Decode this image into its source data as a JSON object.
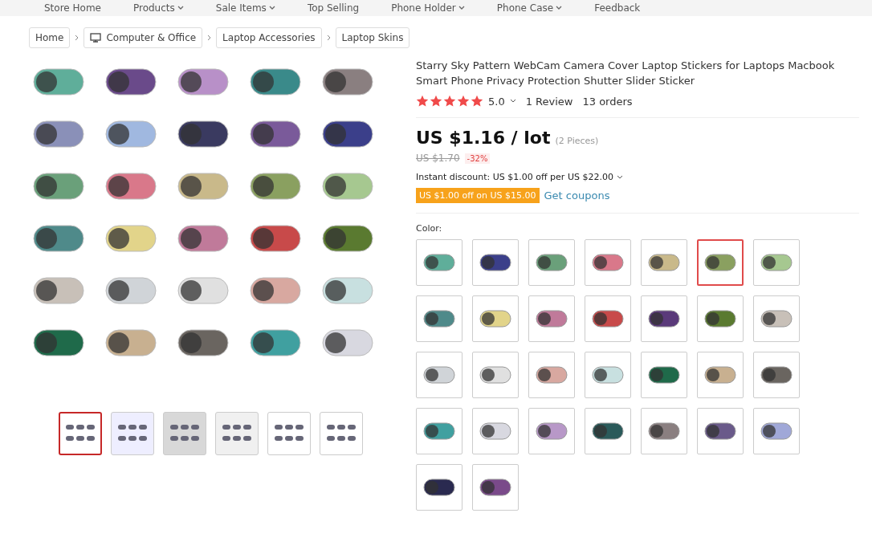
{
  "nav": [
    "Store Home",
    "Products",
    "Sale Items",
    "Top Selling",
    "Phone Holder",
    "Phone Case",
    "Feedback"
  ],
  "nav_dropdown": [
    false,
    true,
    true,
    false,
    true,
    true,
    false
  ],
  "breadcrumb": [
    {
      "label": "Home",
      "kind": "plain"
    },
    {
      "label": "Computer & Office",
      "kind": "icon"
    },
    {
      "label": "Laptop Accessories",
      "kind": "plain"
    },
    {
      "label": "Laptop Skins",
      "kind": "plain"
    }
  ],
  "thumbnails": [
    {
      "selected": true
    },
    {
      "selected": false
    },
    {
      "selected": false
    },
    {
      "selected": false
    },
    {
      "selected": false
    },
    {
      "selected": false
    }
  ],
  "product": {
    "title": "Starry Sky Pattern WebCam Camera Cover Laptop Stickers for Laptops Macbook Smart Phone Privacy Protection Shutter Slider Sticker",
    "stars": 5,
    "rating": "5.0",
    "reviews": "1 Review",
    "orders": "13 orders",
    "price": "US $1.16 / lot",
    "pieces": "(2 Pieces)",
    "old_price": "US $1.70",
    "discount": "-32%",
    "instant_discount": "Instant discount: US $1.00 off per US $22.00",
    "coupon": "US $1.00 off on US $15.00",
    "coupon_link": "Get coupons",
    "color_label": "Color:"
  },
  "swatches": [
    {
      "color": "#5fae9a",
      "selected": false
    },
    {
      "color": "#3b3f8a",
      "selected": false
    },
    {
      "color": "#6aa07a",
      "selected": false
    },
    {
      "color": "#d9788a",
      "selected": false
    },
    {
      "color": "#c9b98a",
      "selected": false
    },
    {
      "color": "#8aa060",
      "selected": true
    },
    {
      "color": "#a6c890",
      "selected": false
    },
    {
      "color": "#4f8a8a",
      "selected": false
    },
    {
      "color": "#e2d48a",
      "selected": false
    },
    {
      "color": "#c07a9a",
      "selected": false
    },
    {
      "color": "#c84a4a",
      "selected": false
    },
    {
      "color": "#5a3a7a",
      "selected": false
    },
    {
      "color": "#5a7a30",
      "selected": false
    },
    {
      "color": "#c8c0b8",
      "selected": false
    },
    {
      "color": "#d0d4d8",
      "selected": false
    },
    {
      "color": "#e0e0e0",
      "selected": false
    },
    {
      "color": "#d8a8a0",
      "selected": false
    },
    {
      "color": "#c8e0e0",
      "selected": false
    },
    {
      "color": "#1f6a4a",
      "selected": false
    },
    {
      "color": "#c8b090",
      "selected": false
    },
    {
      "color": "#6a6560",
      "selected": false
    },
    {
      "color": "#40a0a0",
      "selected": false
    },
    {
      "color": "#d8d8e0",
      "selected": false
    },
    {
      "color": "#b898c8",
      "selected": false
    },
    {
      "color": "#2a5a5a",
      "selected": false
    },
    {
      "color": "#8a7f80",
      "selected": false
    },
    {
      "color": "#6a5a8a",
      "selected": false
    },
    {
      "color": "#a0a8d8",
      "selected": false
    },
    {
      "color": "#2a2a50",
      "selected": false
    },
    {
      "color": "#7a4a8a",
      "selected": false
    }
  ]
}
